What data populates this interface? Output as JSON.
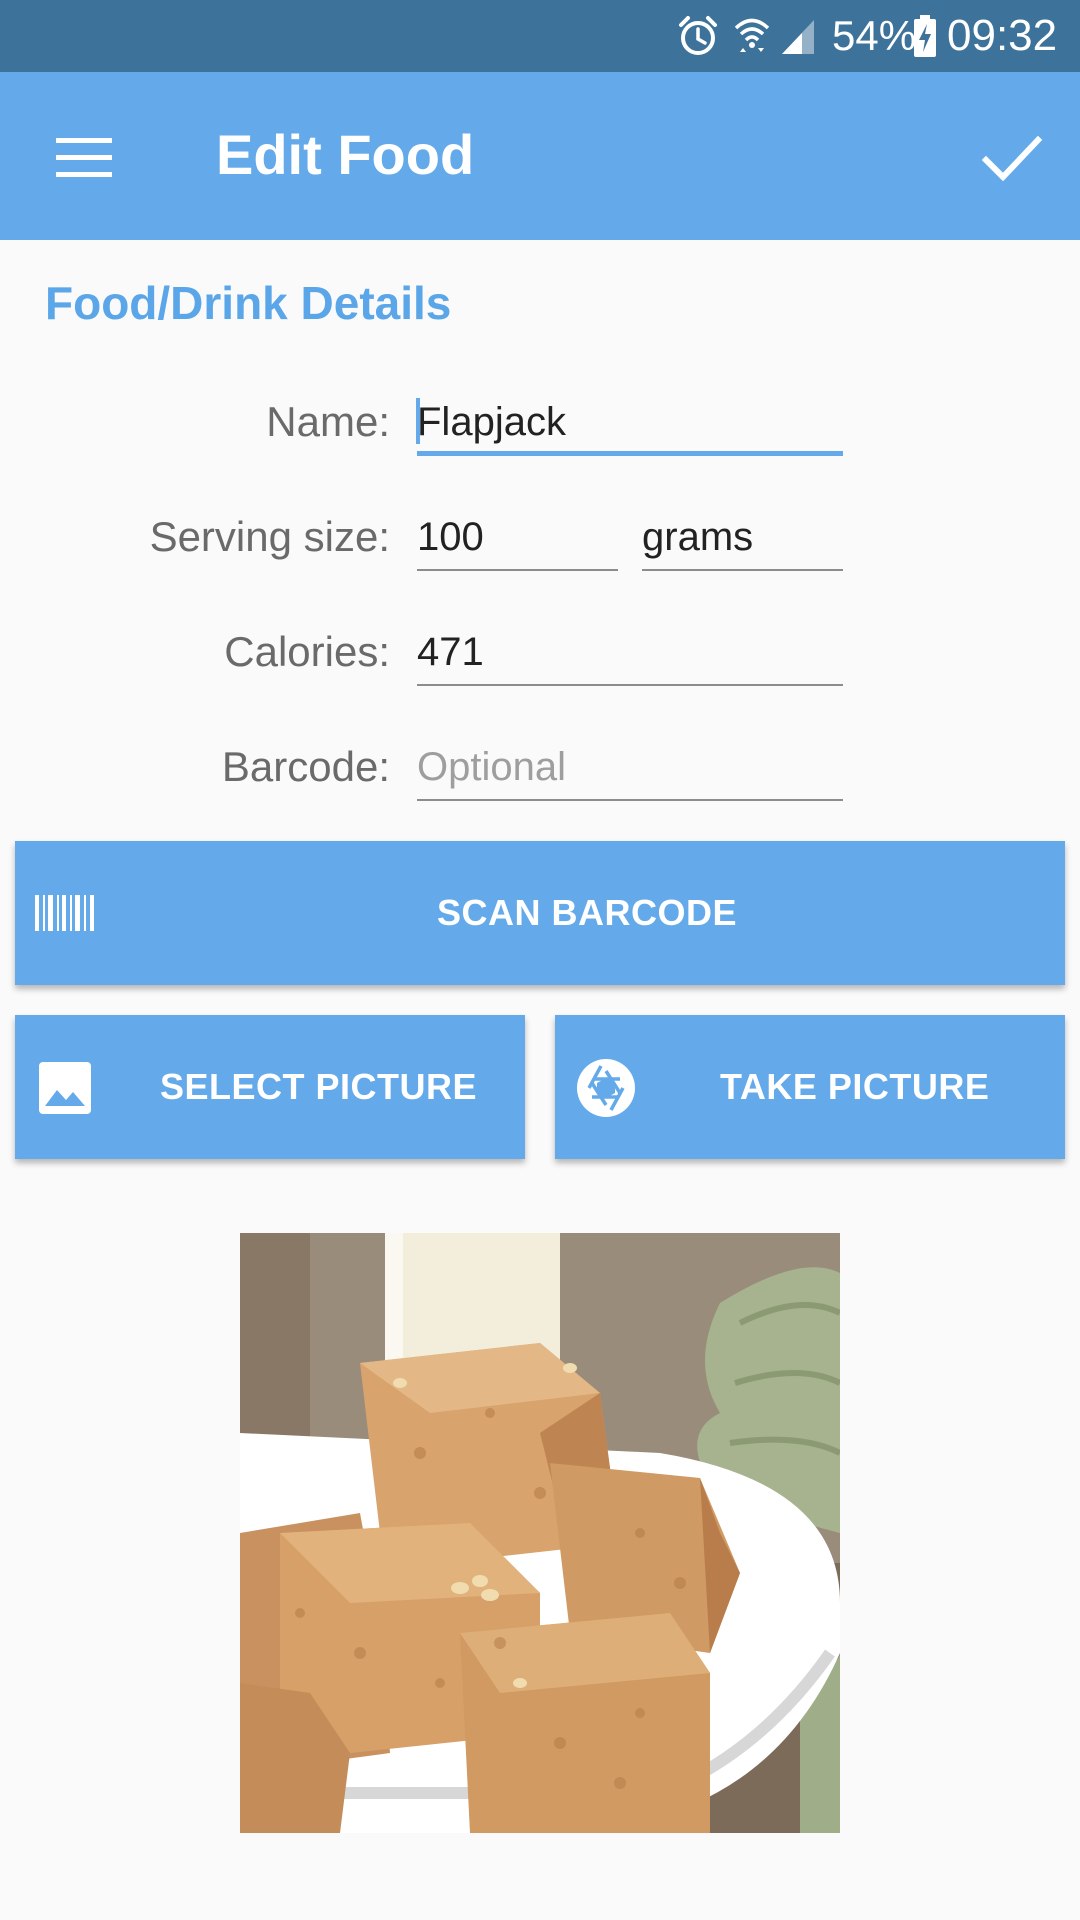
{
  "status_bar": {
    "battery_percent": "54%",
    "clock": "09:32",
    "icons": [
      "alarm-icon",
      "wifi-icon",
      "signal-icon",
      "battery-charging-icon"
    ]
  },
  "toolbar": {
    "title": "Edit Food",
    "menu_icon": "hamburger-menu-icon",
    "confirm_icon": "check-icon"
  },
  "form": {
    "section_title": "Food/Drink Details",
    "name": {
      "label": "Name:",
      "value": "Flapjack"
    },
    "serving_size": {
      "label": "Serving size:",
      "value": "100",
      "unit": "grams"
    },
    "calories": {
      "label": "Calories:",
      "value": "471"
    },
    "barcode": {
      "label": "Barcode:",
      "value": "",
      "placeholder": "Optional"
    }
  },
  "actions": {
    "scan_barcode": {
      "label": "SCAN BARCODE",
      "icon": "barcode-icon"
    },
    "select_picture": {
      "label": "SELECT PICTURE",
      "icon": "image-icon"
    },
    "take_picture": {
      "label": "TAKE PICTURE",
      "icon": "camera-shutter-icon"
    }
  },
  "photo": {
    "subject": "food-photo"
  },
  "colors": {
    "status_bar": "#3d729a",
    "toolbar": "#64aaea",
    "accent": "#5aa6e8",
    "background": "#fafafa"
  }
}
